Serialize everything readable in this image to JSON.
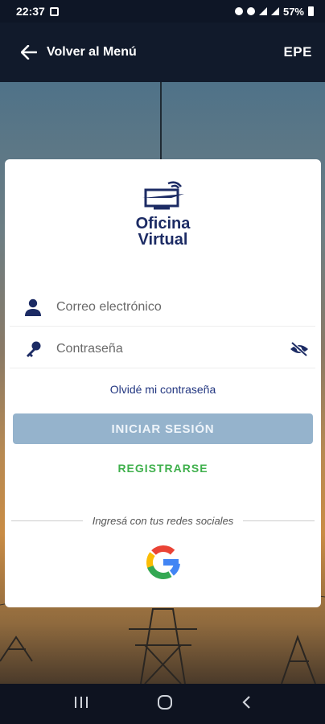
{
  "status": {
    "time": "22:37",
    "battery": "57%"
  },
  "appbar": {
    "back_label": "Volver al Menú",
    "brand": "EPE"
  },
  "logo": {
    "line1": "Oficina",
    "line2": "Virtual"
  },
  "form": {
    "email_placeholder": "Correo electrónico",
    "password_placeholder": "Contraseña",
    "forgot_label": "Olvidé mi contraseña",
    "login_label": "INICIAR SESIÓN",
    "register_label": "REGISTRARSE",
    "social_label": "Ingresá con tus redes sociales"
  },
  "colors": {
    "primary": "#1c2b64",
    "button": "#95b3cc",
    "register": "#3fb04c"
  }
}
